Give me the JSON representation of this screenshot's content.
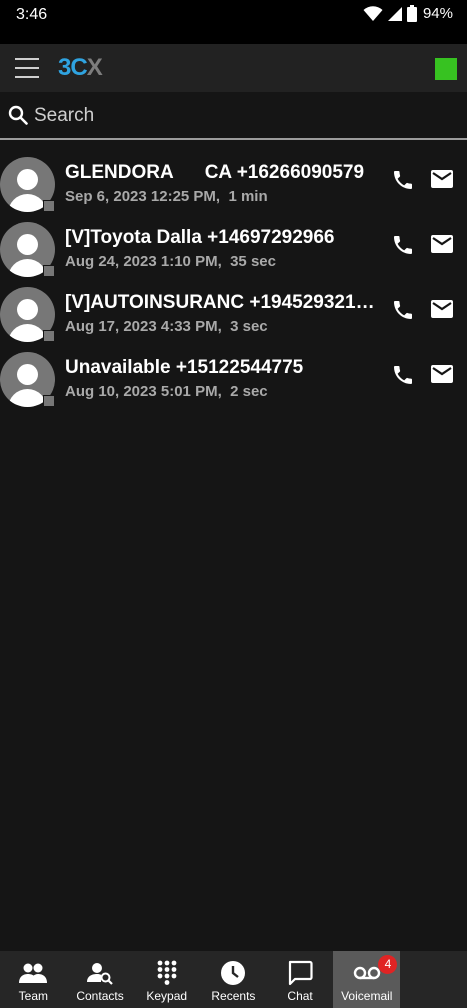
{
  "status_bar": {
    "time": "3:46",
    "battery": "94%"
  },
  "app_bar": {
    "logo_part1": "3C",
    "logo_part2": "X",
    "status_color": "#37c221"
  },
  "search": {
    "placeholder": "Search",
    "value": ""
  },
  "voicemails": [
    {
      "caller": "GLENDORA      CA +16266090579",
      "date": "Sep 6, 2023 12:25 PM,",
      "duration": "1 min"
    },
    {
      "caller": "[V]Toyota Dalla +14697292966",
      "date": "Aug 24, 2023 1:10 PM,",
      "duration": "35 sec"
    },
    {
      "caller": "[V]AUTOINSURANC +194529321…",
      "date": "Aug 17, 2023 4:33 PM,",
      "duration": "3 sec"
    },
    {
      "caller": "Unavailable +15122544775",
      "date": "Aug 10, 2023 5:01 PM,",
      "duration": "2 sec"
    }
  ],
  "bottom_nav": [
    {
      "label": "Team",
      "icon": "team-icon"
    },
    {
      "label": "Contacts",
      "icon": "contacts-search-icon"
    },
    {
      "label": "Keypad",
      "icon": "keypad-icon"
    },
    {
      "label": "Recents",
      "icon": "clock-icon"
    },
    {
      "label": "Chat",
      "icon": "chat-icon"
    },
    {
      "label": "Voicemail",
      "icon": "voicemail-icon",
      "badge": "4",
      "active": true
    }
  ],
  "colors": {
    "accent_blue": "#2fa3e0",
    "badge_red": "#e02424",
    "active_tab": "#5a5a5a"
  }
}
